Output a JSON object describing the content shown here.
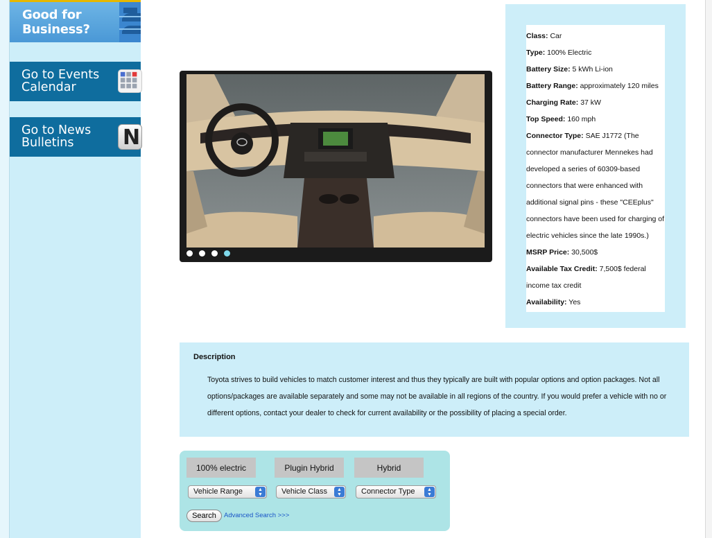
{
  "sidebar": {
    "business": {
      "line1": "Good for",
      "line2": "Business?"
    },
    "events": {
      "line1": "Go to Events",
      "line2": "Calendar"
    },
    "news": {
      "line1": "Go to News",
      "line2": "Bulletins",
      "icon_letter": "N"
    }
  },
  "carousel": {
    "slides": 4,
    "active_slide": 4,
    "image_subject": "Toyota car interior dashboard"
  },
  "specs": [
    {
      "label": "Class:",
      "value": "Car"
    },
    {
      "label": "Type:",
      "value": "100% Electric"
    },
    {
      "label": "Battery Size:",
      "value": "5 kWh Li-ion"
    },
    {
      "label": "Battery Range:",
      "value": "approximately 120 miles"
    },
    {
      "label": "Charging Rate:",
      "value": "37 kW"
    },
    {
      "label": "Top Speed:",
      "value": "160 mph"
    },
    {
      "label": "Connector Type:",
      "value": "SAE J1772 (The connector manufacturer Mennekes had developed a series of 60309-based connectors that were enhanced with additional signal pins - these \"CEEplus\" connectors have been used for charging of electric vehicles since the late 1990s.)"
    },
    {
      "label": "MSRP Price:",
      "value": "30,500$"
    },
    {
      "label": "Available Tax Credit:",
      "value": "7,500$ federal income tax credit"
    },
    {
      "label": "Availability:",
      "value": "Yes"
    }
  ],
  "description": {
    "title": "Description",
    "text": "Toyota strives to build vehicles to match customer interest and thus they typically are built with popular options and option packages. Not all options/packages are available separately and some may not be available in all regions of the country. If you would prefer a vehicle with no or different options, contact your dealer to check for current availability or the possibility of placing a special order."
  },
  "search": {
    "types": [
      "100% electric",
      "Plugin Hybrid",
      "Hybrid"
    ],
    "selects": [
      "Vehicle Range",
      "Vehicle Class",
      "Connector Type"
    ],
    "search_label": "Search",
    "advanced_label": "Advanced Search >>>"
  },
  "colors": {
    "sidebar_bg": "#cdeef9",
    "nav_button": "#0f6d9e",
    "panel_bg": "#cdeef9",
    "search_bg": "#ade4e6",
    "link": "#1a55c7",
    "active_dot": "#7fd8ea"
  }
}
